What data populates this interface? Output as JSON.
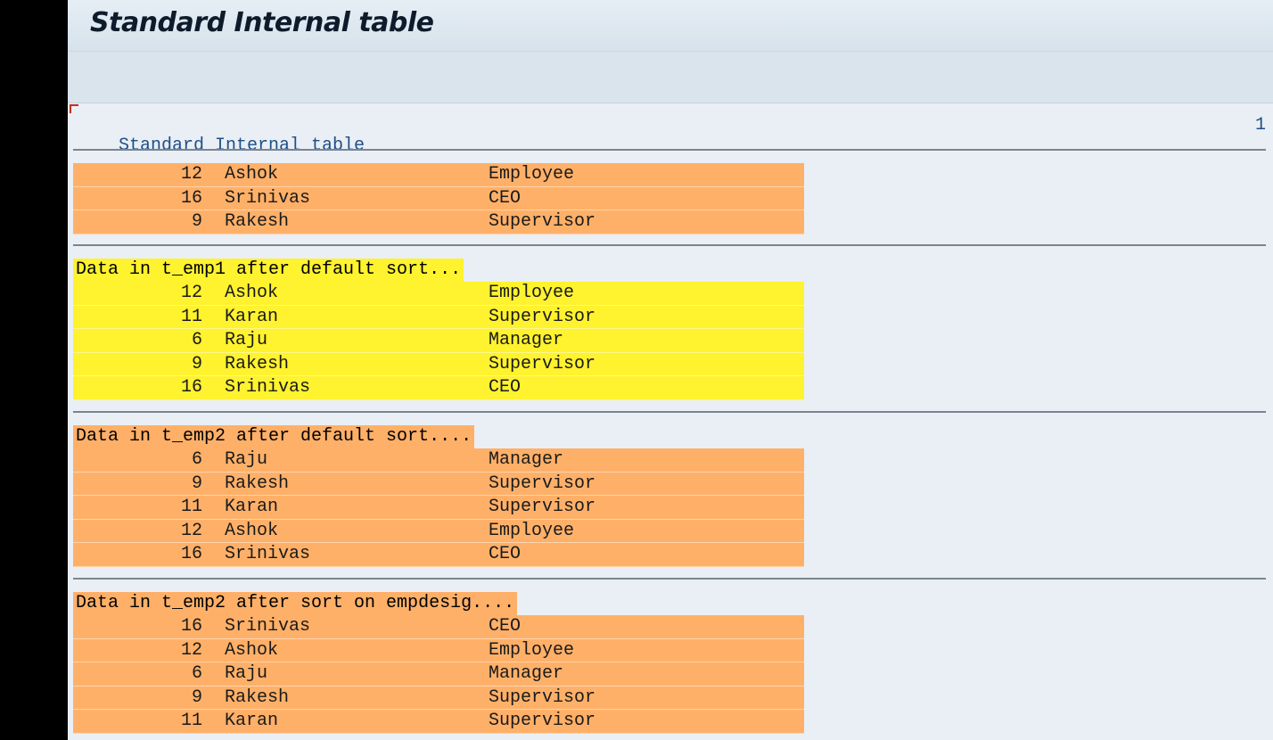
{
  "window": {
    "title": "Standard Internal table"
  },
  "list": {
    "header_title": "Standard Internal table",
    "page_number": "1"
  },
  "sections": [
    {
      "caption": "",
      "color": "#ffb068",
      "rows": [
        {
          "id": "12",
          "name": "Ashok",
          "designation": "Employee"
        },
        {
          "id": "16",
          "name": "Srinivas",
          "designation": "CEO"
        },
        {
          "id": "9",
          "name": "Rakesh",
          "designation": "Supervisor"
        }
      ]
    },
    {
      "caption": "Data in t_emp1 after default sort...",
      "color": "#fff22e",
      "rows": [
        {
          "id": "12",
          "name": "Ashok",
          "designation": "Employee"
        },
        {
          "id": "11",
          "name": "Karan",
          "designation": "Supervisor"
        },
        {
          "id": "6",
          "name": "Raju",
          "designation": "Manager"
        },
        {
          "id": "9",
          "name": "Rakesh",
          "designation": "Supervisor"
        },
        {
          "id": "16",
          "name": "Srinivas",
          "designation": "CEO"
        }
      ]
    },
    {
      "caption": "Data in t_emp2 after default sort....",
      "color": "#ffb068",
      "rows": [
        {
          "id": "6",
          "name": "Raju",
          "designation": "Manager"
        },
        {
          "id": "9",
          "name": "Rakesh",
          "designation": "Supervisor"
        },
        {
          "id": "11",
          "name": "Karan",
          "designation": "Supervisor"
        },
        {
          "id": "12",
          "name": "Ashok",
          "designation": "Employee"
        },
        {
          "id": "16",
          "name": "Srinivas",
          "designation": "CEO"
        }
      ]
    },
    {
      "caption": "Data in t_emp2 after sort on empdesig....",
      "color": "#ffb068",
      "rows": [
        {
          "id": "16",
          "name": "Srinivas",
          "designation": "CEO"
        },
        {
          "id": "12",
          "name": "Ashok",
          "designation": "Employee"
        },
        {
          "id": "6",
          "name": "Raju",
          "designation": "Manager"
        },
        {
          "id": "9",
          "name": "Rakesh",
          "designation": "Supervisor"
        },
        {
          "id": "11",
          "name": "Karan",
          "designation": "Supervisor"
        }
      ]
    }
  ]
}
